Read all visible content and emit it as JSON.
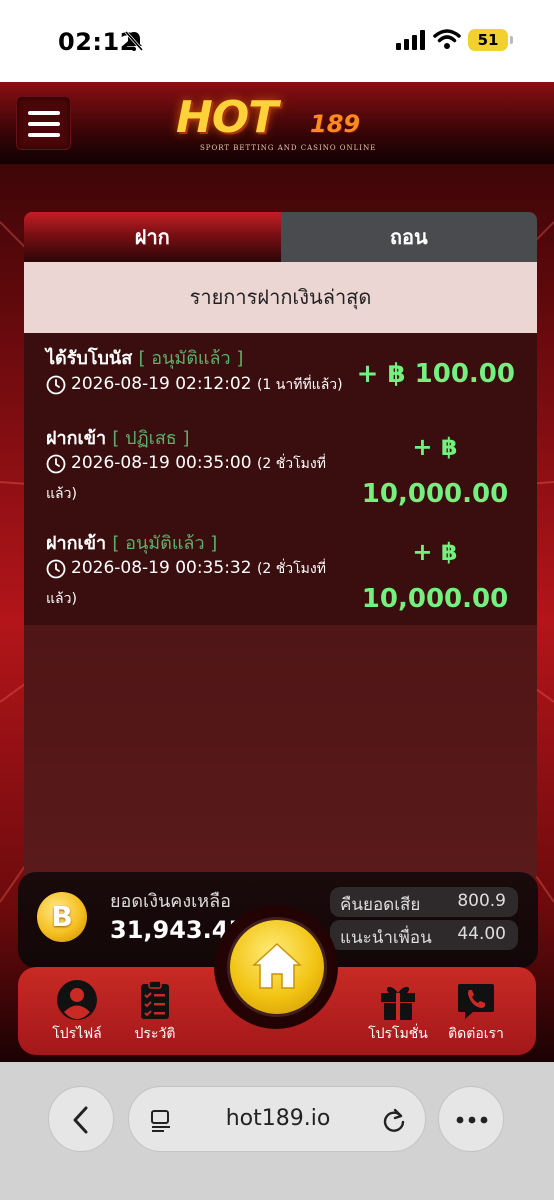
{
  "status_bar": {
    "time": "02:12",
    "battery": "51"
  },
  "header": {
    "logo_text": "HOT",
    "logo_number": "189",
    "logo_tagline": "SPORT BETTING AND CASINO ONLINE"
  },
  "tabs": [
    {
      "label": "ฝาก",
      "active": true
    },
    {
      "label": "ถอน",
      "active": false
    }
  ],
  "list_heading": "รายการฝากเงินล่าสุด",
  "transactions": [
    {
      "title": "ได้รับโบนัส",
      "status": "[ อนุมัติแล้ว ]",
      "datetime": "2026-08-19 02:12:02",
      "ago": "(1 นาทีที่แล้ว)",
      "ago_line2": "",
      "amount_prefix": "+ ฿",
      "amount": "100.00"
    },
    {
      "title": "ฝากเข้า",
      "status": "[ ปฏิเสธ ]",
      "datetime": "2026-08-19 00:35:00",
      "ago": "(2 ชั่วโมงที่",
      "ago_line2": "แล้ว)",
      "amount_prefix": "+ ฿",
      "amount": "10,000.00"
    },
    {
      "title": "ฝากเข้า",
      "status": "[ อนุมัติแล้ว ]",
      "datetime": "2026-08-19 00:35:32",
      "ago": "(2 ชั่วโมงที่",
      "ago_line2": "แล้ว)",
      "amount_prefix": "+ ฿",
      "amount": "10,000.00"
    }
  ],
  "balance": {
    "coin_symbol": "B",
    "label": "ยอดเงินคงเหลือ",
    "value": "31,943.45",
    "cashback_label": "คืนยอดเสีย",
    "cashback_value": "800.9",
    "referral_label": "แนะนำเพื่อน",
    "referral_value": "44.00"
  },
  "nav": {
    "profile": "โปรไฟล์",
    "history": "ประวัติ",
    "promotion": "โปรโมชั่น",
    "contact": "ติดต่อเรา"
  },
  "browser": {
    "url": "hot189.io"
  },
  "colors": {
    "accent_red": "#c92a24",
    "amount_green": "#74f07f",
    "approved_green": "#5fae6a",
    "gold": "#f2c413"
  }
}
